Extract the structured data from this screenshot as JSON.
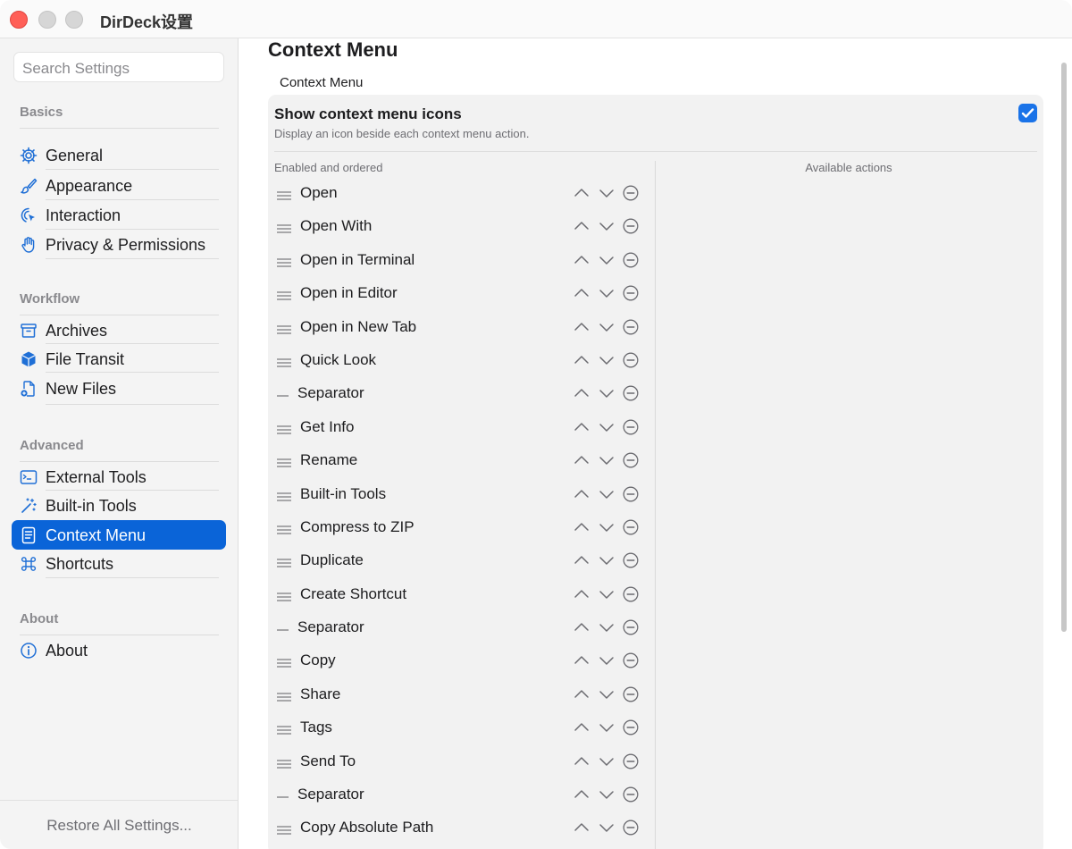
{
  "window": {
    "title": "DirDeck设置"
  },
  "sidebar": {
    "search_placeholder": "Search Settings",
    "sections": {
      "basics": "Basics",
      "workflow": "Workflow",
      "advanced": "Advanced",
      "about": "About"
    },
    "items": {
      "general": "General",
      "appearance": "Appearance",
      "interaction": "Interaction",
      "privacy": "Privacy & Permissions",
      "archives": "Archives",
      "file_transit": "File Transit",
      "new_files": "New Files",
      "external_tools": "External Tools",
      "builtin_tools": "Built-in Tools",
      "context_menu": "Context Menu",
      "shortcuts": "Shortcuts",
      "about": "About"
    },
    "selected": "Context Menu",
    "restore_label": "Restore All Settings..."
  },
  "main": {
    "title": "Context Menu",
    "group_label": "Context Menu",
    "toggle": {
      "title": "Show context menu icons",
      "description": "Display an icon beside each context menu action.",
      "checked": true
    },
    "enabled_header": "Enabled and ordered",
    "available_header": "Available actions",
    "enabled_items": [
      "Open",
      "Open With",
      "Open in Terminal",
      "Open in Editor",
      "Open in New Tab",
      "Quick Look",
      "Separator",
      "Get Info",
      "Rename",
      "Built-in Tools",
      "Compress to ZIP",
      "Duplicate",
      "Create Shortcut",
      "Separator",
      "Copy",
      "Share",
      "Tags",
      "Send To",
      "Separator",
      "Copy Absolute Path"
    ]
  },
  "colors": {
    "accent": "#0a64d8",
    "checkbox": "#1a73e8",
    "close": "#ff5f57",
    "sidebar_bg": "#f4f4f4",
    "panel_bg": "#f2f2f2"
  }
}
